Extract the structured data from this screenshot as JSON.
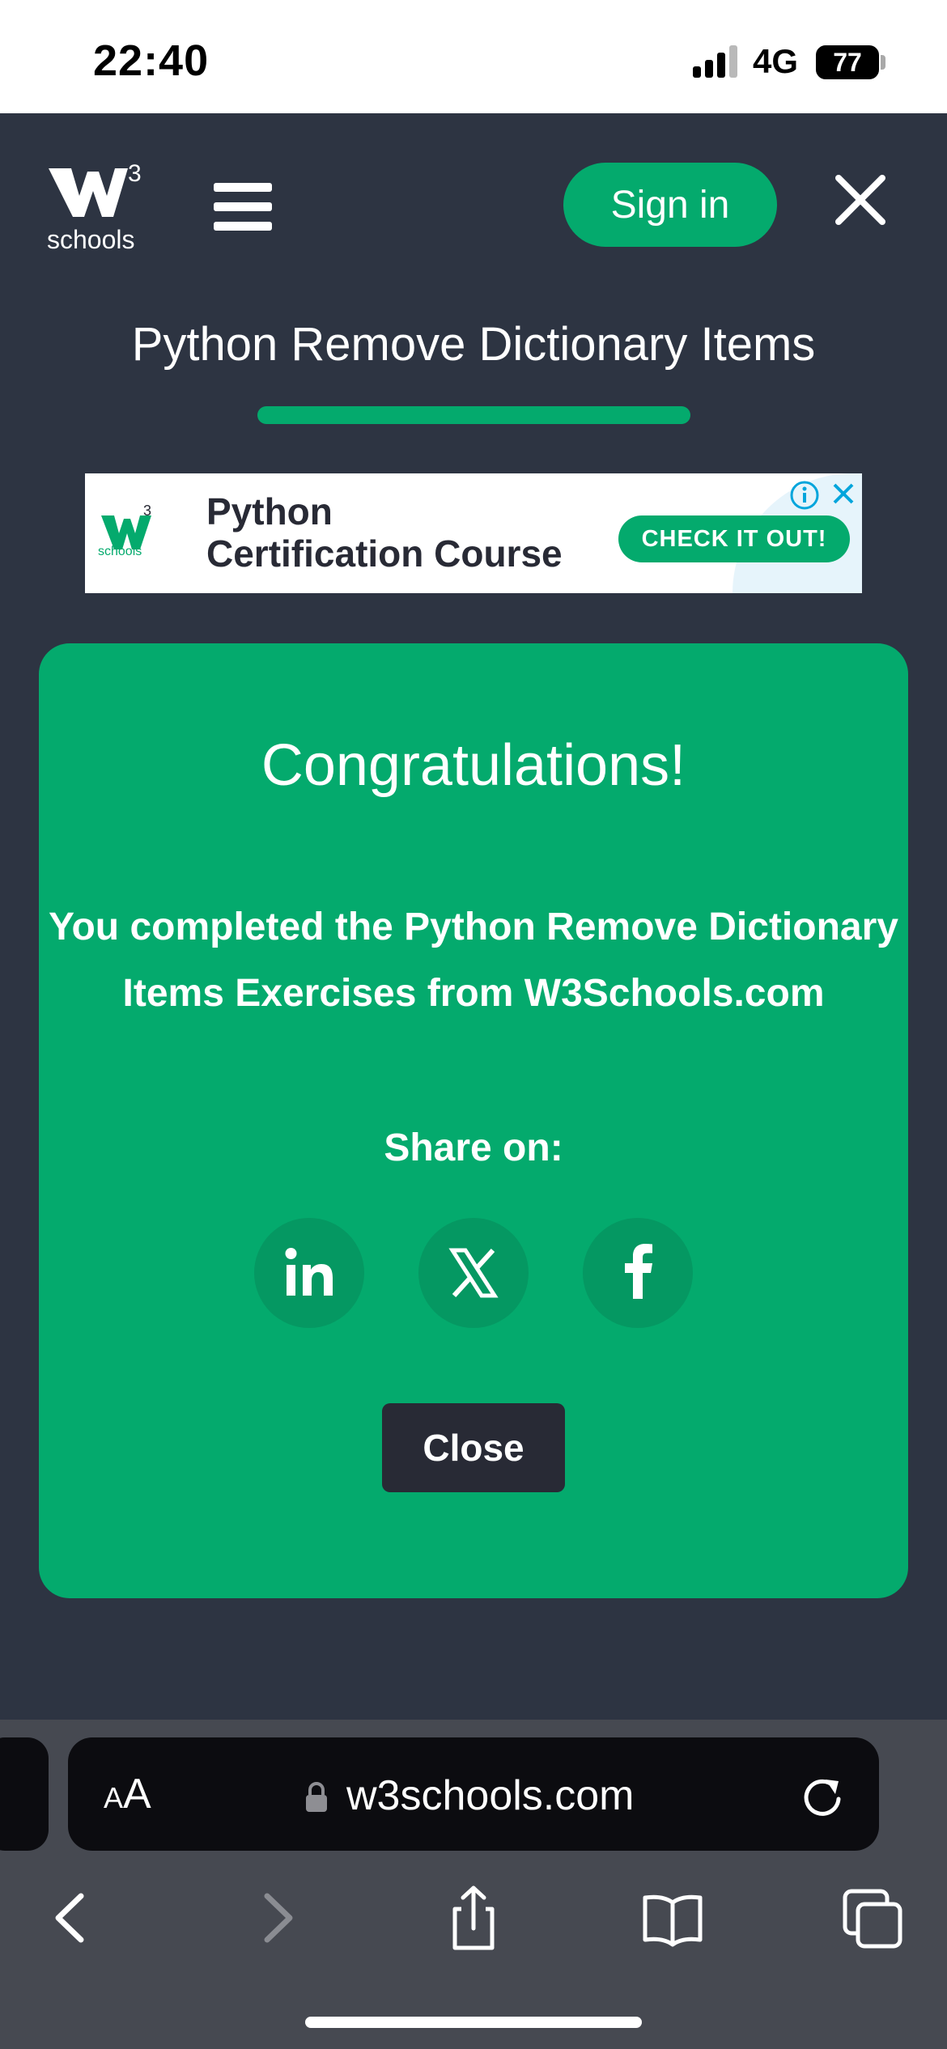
{
  "status_bar": {
    "time": "22:40",
    "network": "4G",
    "battery": "77"
  },
  "header": {
    "logo_superscript": "3",
    "logo_text": "schools",
    "sign_in_label": "Sign in"
  },
  "page": {
    "title": "Python Remove Dictionary Items"
  },
  "ad": {
    "logo_superscript": "3",
    "logo_text": "schools",
    "line1": "Python",
    "line2": "Certification Course",
    "cta": "CHECK IT OUT!"
  },
  "modal": {
    "title": "Congratulations!",
    "message_line1": "You completed the Python Remove Dictionary",
    "message_line2": "Items Exercises from W3Schools.com",
    "share_label": "Share on:",
    "share_icons": [
      "linkedin-icon",
      "x-icon",
      "facebook-icon"
    ],
    "close_label": "Close"
  },
  "browser": {
    "text_size_label_small": "A",
    "text_size_label_large": "A",
    "url": "w3schools.com"
  },
  "colors": {
    "brand_green": "#04aa6d",
    "page_bg": "#2d3442",
    "dark_button": "#282a35"
  }
}
